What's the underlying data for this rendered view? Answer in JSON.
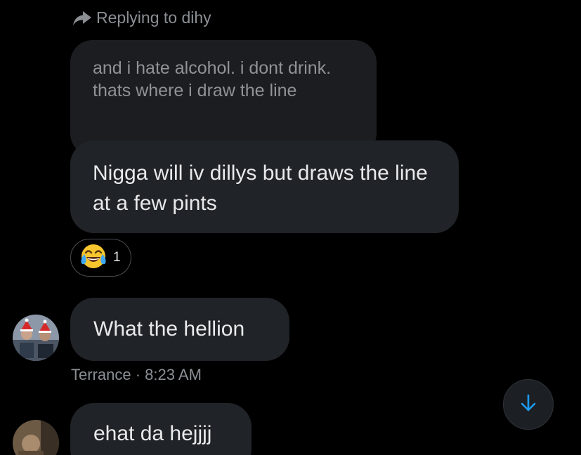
{
  "reply_header": {
    "label": "Replying to dihy"
  },
  "quoted_message": {
    "text": "and i hate alcohol. i dont drink. thats where i draw the line"
  },
  "messages": [
    {
      "text": "Nigga will iv dillys but draws the line at a few pints"
    },
    {
      "text": "What the hellion"
    },
    {
      "text": "ehat da hejjjj"
    }
  ],
  "reaction": {
    "emoji": "face-with-tears-of-joy",
    "count": "1"
  },
  "meta": {
    "sender": "Terrance",
    "separator": "·",
    "time": "8:23 AM"
  },
  "colors": {
    "background": "#000000",
    "bubble": "#202327",
    "quoted_bubble": "#1c1d20",
    "muted_text": "#8b8f94",
    "accent": "#1d9bf0"
  }
}
